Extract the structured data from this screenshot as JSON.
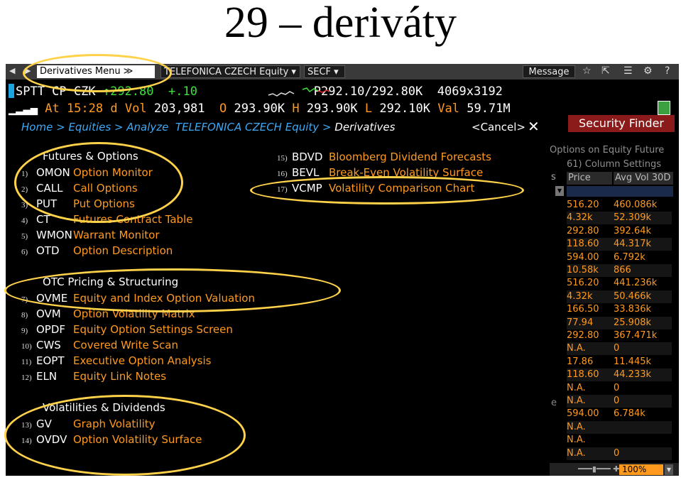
{
  "slide": {
    "title": "29 – deriváty"
  },
  "toolbar": {
    "derivatives_menu": "Derivatives Menu ≫",
    "security": "TELEFONICA CZECH Equity ▾",
    "function": "SECF ▾",
    "message": "Message"
  },
  "quote": {
    "ticker": "SPTT CP CZK",
    "arrow": "↑",
    "last": "292.80",
    "change": "+.10",
    "bid_prefix": "P",
    "bid": "292.10",
    "ask": "/292.80",
    "ask_suffix": "K",
    "size": "4069",
    "size_x": "x3192",
    "at_label": "At",
    "time": "15:28",
    "time_flag": "d",
    "vol_label": "Vol",
    "vol": "203,981",
    "open_label": "O",
    "open": "293.90",
    "open_suffix": "K",
    "high_label": "H",
    "high": "293.90",
    "high_suffix": "K",
    "low_label": "L",
    "low": "292.10",
    "low_suffix": "K",
    "val_label": "Val",
    "val": "59.71M"
  },
  "breadcrumb": {
    "path": "Home > Equities > Analyze  TELEFONICA CZECH Equity > ",
    "current": "Derivatives"
  },
  "menu": {
    "cancel": "<Cancel>",
    "sections": {
      "futures": "Futures & Options",
      "otc": "OTC Pricing & Structuring",
      "vol": "Volatilities & Dividends"
    },
    "items": [
      {
        "num": "1)",
        "code": "OMON",
        "label": "Option Monitor"
      },
      {
        "num": "2)",
        "code": "CALL",
        "label": "Call Options"
      },
      {
        "num": "3)",
        "code": "PUT",
        "label": "Put Options"
      },
      {
        "num": "4)",
        "code": "CT",
        "label": "Futures Contract Table"
      },
      {
        "num": "5)",
        "code": "WMON",
        "label": "Warrant Monitor"
      },
      {
        "num": "6)",
        "code": "OTD",
        "label": "Option Description"
      },
      {
        "num": "7)",
        "code": "OVME",
        "label": "Equity and Index Option Valuation"
      },
      {
        "num": "8)",
        "code": "OVM",
        "label": "Option Volatility Matrix"
      },
      {
        "num": "9)",
        "code": "OPDF",
        "label": "Equity Option Settings Screen"
      },
      {
        "num": "10)",
        "code": "CWS",
        "label": "Covered Write Scan"
      },
      {
        "num": "11)",
        "code": "EOPT",
        "label": "Executive Option Analysis"
      },
      {
        "num": "12)",
        "code": "ELN",
        "label": "Equity Link Notes"
      },
      {
        "num": "13)",
        "code": "GV",
        "label": "Graph Volatility"
      },
      {
        "num": "14)",
        "code": "OVDV",
        "label": "Option Volatility Surface"
      },
      {
        "num": "15)",
        "code": "BDVD",
        "label": "Bloomberg Dividend Forecasts"
      },
      {
        "num": "16)",
        "code": "BEVL",
        "label": "Break-Even Volatility Surface"
      },
      {
        "num": "17)",
        "code": "VCMP",
        "label": "Volatility Comparison Chart"
      }
    ]
  },
  "finder": {
    "button": "Security Finder",
    "subtitle": "Options on Equity Future",
    "column_settings": "61) Column Settings",
    "s_fragment": "s",
    "e_fragment": "e",
    "headers": {
      "price": "Price",
      "avg_vol": "Avg Vol 30D"
    },
    "rows": [
      {
        "price": "516.20",
        "avg_vol": "460.086k"
      },
      {
        "price": "4.32k",
        "avg_vol": "52.309k"
      },
      {
        "price": "292.80",
        "avg_vol": "392.64k"
      },
      {
        "price": "118.60",
        "avg_vol": "44.317k"
      },
      {
        "price": "594.00",
        "avg_vol": "6.792k"
      },
      {
        "price": "10.58k",
        "avg_vol": "866"
      },
      {
        "price": "516.20",
        "avg_vol": "441.236k"
      },
      {
        "price": "4.32k",
        "avg_vol": "50.466k"
      },
      {
        "price": "166.50",
        "avg_vol": "33.836k"
      },
      {
        "price": "77.94",
        "avg_vol": "25.908k"
      },
      {
        "price": "292.80",
        "avg_vol": "367.471k"
      },
      {
        "price": "N.A.",
        "avg_vol": "0"
      },
      {
        "price": "17.86",
        "avg_vol": "11.445k"
      },
      {
        "price": "118.60",
        "avg_vol": "44.233k"
      },
      {
        "price": "N.A.",
        "avg_vol": "0"
      },
      {
        "price": "N.A.",
        "avg_vol": "0"
      },
      {
        "price": "594.00",
        "avg_vol": "6.784k"
      },
      {
        "price": "N.A.",
        "avg_vol": ""
      },
      {
        "price": "N.A.",
        "avg_vol": ""
      },
      {
        "price": "N.A.",
        "avg_vol": "0"
      }
    ],
    "zoom": "100%"
  },
  "colors": {
    "accent": "#ff9a1f",
    "link": "#3fa9f5",
    "up": "#3de03d",
    "highlight": "#ffd24a",
    "finder": "#8b1a1a"
  }
}
